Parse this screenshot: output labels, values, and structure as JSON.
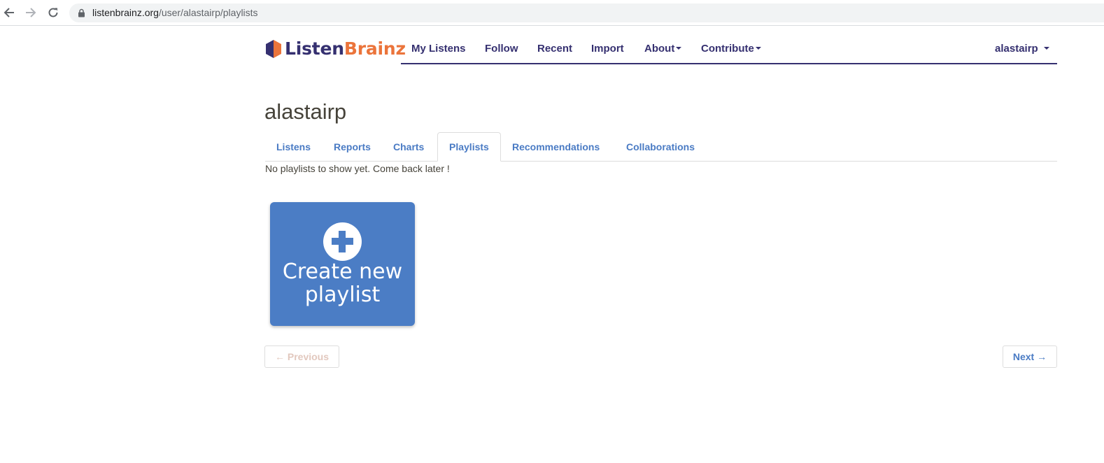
{
  "browser": {
    "url_host": "listenbrainz.org",
    "url_path": "/user/alastairp/playlists"
  },
  "site": {
    "logo_part1": "Listen",
    "logo_part2": "Brainz",
    "brand_colors": {
      "primary": "#353070",
      "accent": "#eb743b",
      "link": "#4a7bc4",
      "card": "#4b7dc5"
    }
  },
  "navbar": {
    "items": [
      {
        "label": "My Listens"
      },
      {
        "label": "Follow"
      },
      {
        "label": "Recent"
      },
      {
        "label": "Import"
      },
      {
        "label": "About"
      },
      {
        "label": "Contribute"
      }
    ],
    "user": "alastairp"
  },
  "page": {
    "title": "alastairp",
    "tabs": [
      {
        "label": "Listens"
      },
      {
        "label": "Reports"
      },
      {
        "label": "Charts"
      },
      {
        "label": "Playlists",
        "active": true
      },
      {
        "label": "Recommendations"
      },
      {
        "label": "Collaborations"
      }
    ],
    "empty_message": "No playlists to show yet. Come back later !",
    "create_card": {
      "line1": "Create new",
      "line2": "playlist",
      "icon": "plus-circle-icon"
    },
    "pagination": {
      "previous": "← Previous",
      "next": "Next →"
    }
  }
}
